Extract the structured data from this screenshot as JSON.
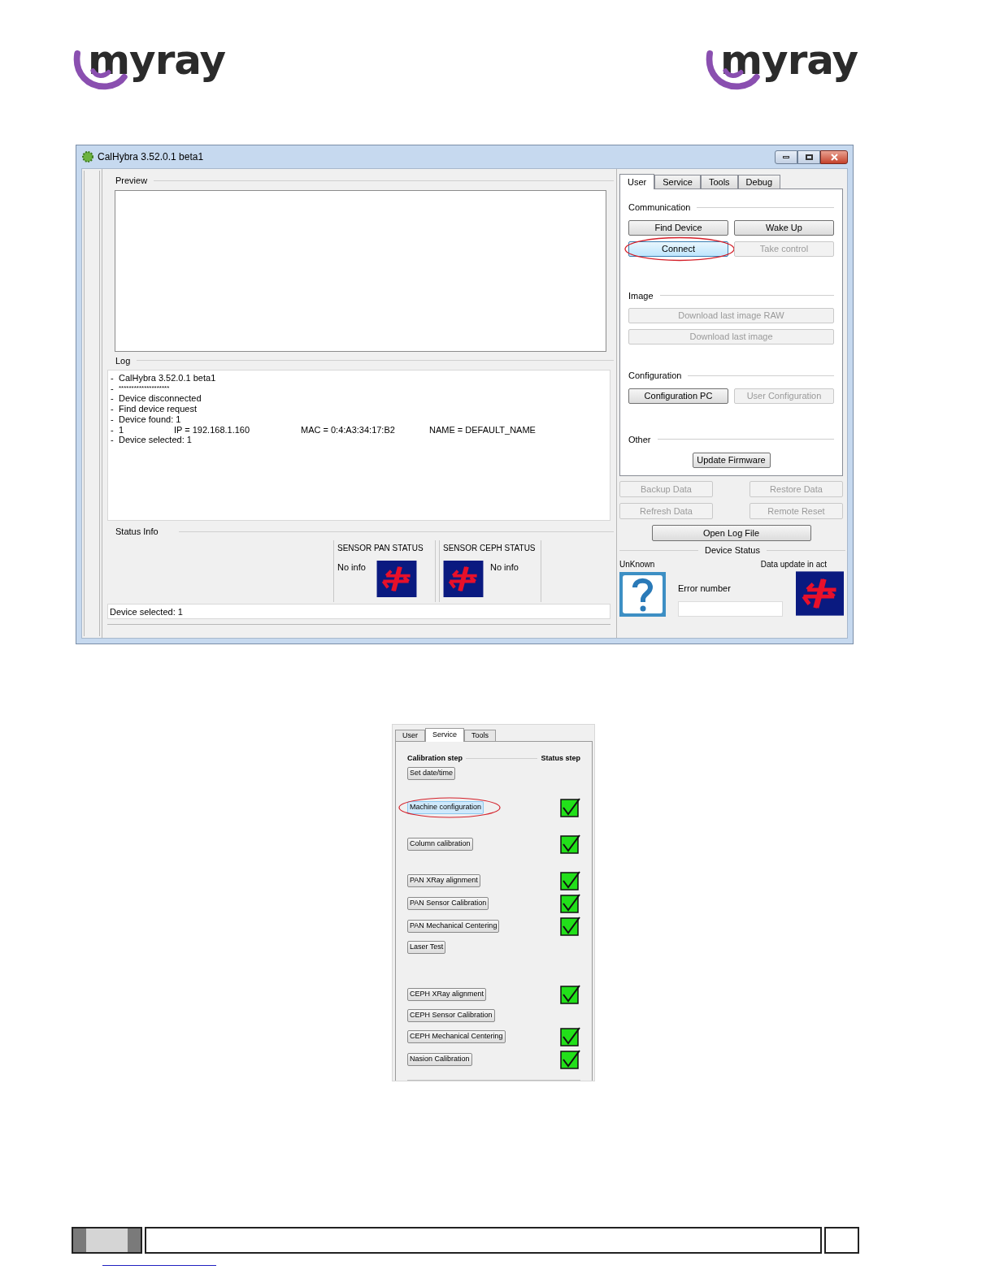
{
  "logos": [
    {
      "text": "myray"
    },
    {
      "text": "myray"
    }
  ],
  "window": {
    "title": "CalHybra 3.52.0.1 beta1"
  },
  "preview": {
    "label": "Preview"
  },
  "log": {
    "label": "Log",
    "lines": [
      {
        "marker": "-",
        "cells": [
          "CalHybra 3.52.0.1 beta1"
        ]
      },
      {
        "marker": "-",
        "cells": [
          "********************"
        ]
      },
      {
        "marker": "-",
        "cells": [
          "Device disconnected"
        ]
      },
      {
        "marker": "-",
        "cells": [
          "Find device request"
        ]
      },
      {
        "marker": "-",
        "cells": [
          "Device found: 1"
        ]
      },
      {
        "marker": "-",
        "cells": [
          "1",
          "IP = 192.168.1.160",
          "MAC = 0:4:A3:34:17:B2",
          "NAME = DEFAULT_NAME"
        ]
      },
      {
        "marker": "-",
        "cells": [
          "Device selected: 1"
        ]
      }
    ]
  },
  "status_info": {
    "label": "Status Info",
    "sensors": [
      {
        "title": "SENSOR PAN STATUS",
        "text": "No info",
        "icon_first": false
      },
      {
        "title": "SENSOR CEPH STATUS",
        "text": "No info",
        "icon_first": true
      }
    ]
  },
  "status_bar": "Device selected: 1",
  "tabs": [
    {
      "label": "User",
      "selected": true
    },
    {
      "label": "Service",
      "selected": false
    },
    {
      "label": "Tools",
      "selected": false
    },
    {
      "label": "Debug",
      "selected": false
    }
  ],
  "groups": [
    {
      "title": "Communication",
      "kind": "pairs",
      "buttons": [
        {
          "label": "Find Device",
          "disabled": false,
          "focused": false,
          "circled": false
        },
        {
          "label": "Wake Up",
          "disabled": false,
          "focused": false,
          "circled": false
        },
        {
          "label": "Connect",
          "disabled": false,
          "focused": true,
          "circled": true
        },
        {
          "label": "Take control",
          "disabled": true,
          "focused": false,
          "circled": false
        }
      ]
    },
    {
      "title": "Image",
      "kind": "full",
      "buttons": [
        {
          "label": "Download last image RAW",
          "disabled": true,
          "focused": false,
          "circled": false
        },
        {
          "label": "Download last image",
          "disabled": true,
          "focused": false,
          "circled": false
        }
      ]
    },
    {
      "title": "Configuration",
      "kind": "pairs",
      "buttons": [
        {
          "label": "Configuration PC",
          "disabled": false,
          "focused": false,
          "circled": false
        },
        {
          "label": "User Configuration",
          "disabled": true,
          "focused": false,
          "circled": false
        }
      ]
    },
    {
      "title": "Other",
      "kind": "center",
      "buttons": [
        {
          "label": "Update Firmware",
          "disabled": false,
          "focused": false,
          "circled": false
        }
      ]
    }
  ],
  "data_buttons": [
    {
      "label": "Backup Data",
      "disabled": true
    },
    {
      "label": "Restore Data",
      "disabled": true
    },
    {
      "label": "Refresh Data",
      "disabled": true
    },
    {
      "label": "Remote Reset",
      "disabled": true
    }
  ],
  "open_log_button": "Open Log File",
  "device_status": {
    "title": "Device Status",
    "state_label": "UnKnown",
    "update_label": "Data update in act",
    "error_label": "Error number"
  },
  "service_panel": {
    "tabs": [
      {
        "label": "User",
        "selected": false
      },
      {
        "label": "Service",
        "selected": true
      },
      {
        "label": "Tools",
        "selected": false
      }
    ],
    "header_left": "Calibration step",
    "header_right": "Status step",
    "steps": [
      {
        "label": "Set date/time",
        "done": false,
        "focused": false,
        "circled": false
      },
      {
        "label": "Machine configuration",
        "done": true,
        "focused": true,
        "circled": true
      },
      {
        "label": "Column calibration",
        "done": true,
        "focused": false,
        "circled": false
      },
      {
        "label": "PAN XRay alignment",
        "done": true,
        "focused": false,
        "circled": false
      },
      {
        "label": "PAN Sensor Calibration",
        "done": true,
        "focused": false,
        "circled": false
      },
      {
        "label": "PAN Mechanical Centering",
        "done": true,
        "focused": false,
        "circled": false
      },
      {
        "label": "Laser Test",
        "done": false,
        "focused": false,
        "circled": false
      },
      {
        "label": "CEPH XRay alignment",
        "done": true,
        "focused": false,
        "circled": false
      },
      {
        "label": "CEPH Sensor Calibration",
        "done": false,
        "focused": false,
        "circled": false
      },
      {
        "label": "CEPH Mechanical Centering",
        "done": true,
        "focused": false,
        "circled": false
      },
      {
        "label": "Nasion Calibration",
        "done": true,
        "focused": false,
        "circled": false
      }
    ]
  }
}
